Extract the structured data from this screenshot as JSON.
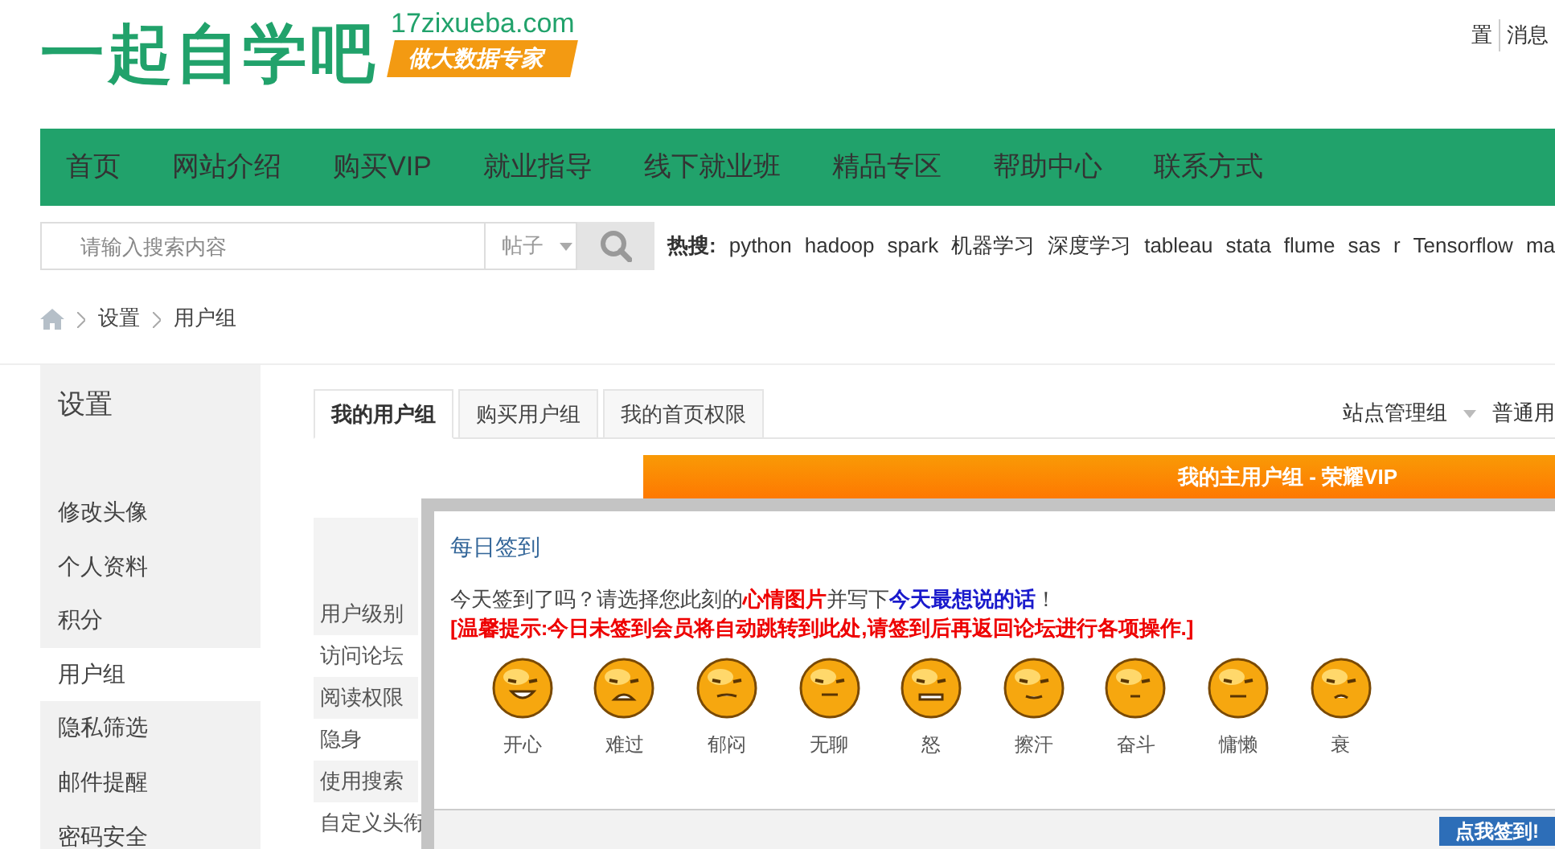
{
  "header": {
    "logo": "一起自学吧",
    "domain": "17zixueba.com",
    "slogan": "做大数据专家",
    "user_links": [
      "置",
      "消息"
    ]
  },
  "nav": [
    {
      "label": "首页"
    },
    {
      "label": "网站介绍"
    },
    {
      "label": "购买VIP"
    },
    {
      "label": "就业指导"
    },
    {
      "label": "线下就业班"
    },
    {
      "label": "精品专区"
    },
    {
      "label": "帮助中心"
    },
    {
      "label": "联系方式"
    }
  ],
  "search": {
    "placeholder": "请输入搜索内容",
    "scope": "帖子",
    "hot_label": "热搜:",
    "hot_terms": [
      "python",
      "hadoop",
      "spark",
      "机器学习",
      "深度学习",
      "tableau",
      "stata",
      "flume",
      "sas",
      "r",
      "Tensorflow",
      "ma"
    ]
  },
  "breadcrumb": [
    "设置",
    "用户组"
  ],
  "sidebar": {
    "title": "设置",
    "items": [
      {
        "label": "修改头像",
        "selected": false
      },
      {
        "label": "个人资料",
        "selected": false
      },
      {
        "label": "积分",
        "selected": false
      },
      {
        "label": "用户组",
        "selected": true
      },
      {
        "label": "隐私筛选",
        "selected": false
      },
      {
        "label": "邮件提醒",
        "selected": false
      },
      {
        "label": "密码安全",
        "selected": false
      }
    ]
  },
  "tabs": [
    {
      "label": "我的用户组",
      "selected": true
    },
    {
      "label": "购买用户组",
      "selected": false
    },
    {
      "label": "我的首页权限",
      "selected": false
    }
  ],
  "group_filter": {
    "value": "站点管理组",
    "column_2": "普通用"
  },
  "banner": "我的主用户组 - 荣耀VIP",
  "permissions": [
    "用户级别",
    "访问论坛",
    "阅读权限",
    "隐身",
    "使用搜索",
    "自定义头衔"
  ],
  "dialog": {
    "title": "每日签到",
    "prompt": "今天签到了吗？请选择您此刻的**心情图片**并写下**今天最想说的话**！",
    "notice": "[温馨提示:今日未签到会员将自动跳转到此处,请签到后再返回论坛进行各项操作.]",
    "moods": [
      "开心",
      "难过",
      "郁闷",
      "无聊",
      "怒",
      "擦汗",
      "奋斗",
      "慵懒",
      "衰"
    ],
    "button": "点我签到!"
  }
}
